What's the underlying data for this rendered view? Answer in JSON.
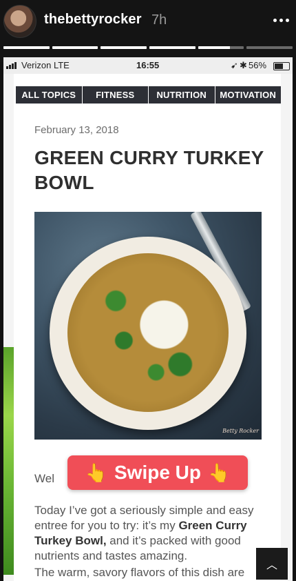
{
  "story": {
    "username": "thebettyrocker",
    "time_ago": "7h",
    "progress": [
      1,
      1,
      1,
      1,
      0.7,
      0
    ]
  },
  "status_bar": {
    "carrier": "Verizon  LTE",
    "time": "16:55",
    "battery": "56%"
  },
  "nav": {
    "items": [
      "ALL TOPICS",
      "FITNESS",
      "NUTRITION",
      "MOTIVATION"
    ]
  },
  "post": {
    "date": "February 13, 2018",
    "title": "GREEN CURRY TURKEY BOWL",
    "image_watermark": "Betty Rocker",
    "intro_partial": "Wel",
    "paragraph1": {
      "before": "Today I’ve got a seriously simple and easy entree for you to try: it’s my ",
      "bold": "Green Curry Turkey Bowl,",
      "after": " and it’s packed with good nutrients and tastes amazing."
    },
    "paragraph2_start": "The warm, savory flavors of this dish are"
  },
  "overlay": {
    "swipe_up_label": "Swipe Up",
    "hand_glyph": "👆"
  },
  "icons": {
    "more": "more-icon",
    "scroll_top": "chevron-up-icon"
  },
  "colors": {
    "nav_bg": "#2d2f36",
    "swipe_bg": "#f04e57",
    "story_bg": "#141414"
  }
}
